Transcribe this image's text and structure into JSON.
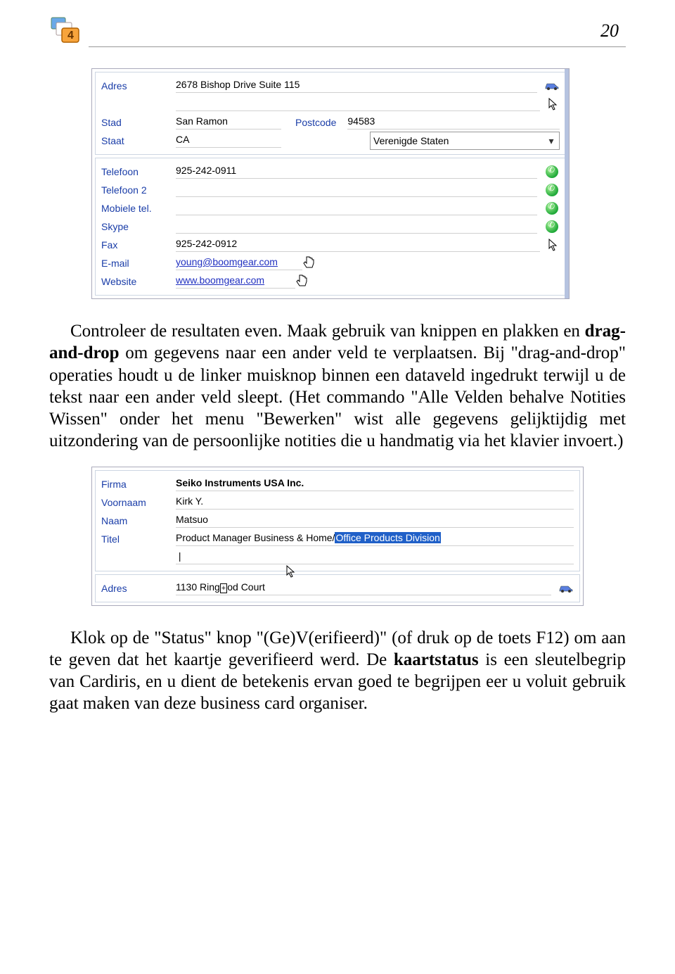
{
  "page_number": "20",
  "screenshot1": {
    "address": {
      "label": "Adres",
      "value": "2678 Bishop Drive Suite 115"
    },
    "city": {
      "label": "Stad",
      "value": "San Ramon"
    },
    "postcode": {
      "label": "Postcode",
      "value": "94583"
    },
    "state": {
      "label": "Staat",
      "value": "CA"
    },
    "country": {
      "value": "Verenigde Staten"
    },
    "phone": {
      "label": "Telefoon",
      "value": "925-242-0911"
    },
    "phone2": {
      "label": "Telefoon 2",
      "value": ""
    },
    "mobile": {
      "label": "Mobiele tel.",
      "value": ""
    },
    "skype": {
      "label": "Skype",
      "value": ""
    },
    "fax": {
      "label": "Fax",
      "value": "925-242-0912"
    },
    "email": {
      "label": "E-mail",
      "value": "young@boomgear.com"
    },
    "website": {
      "label": "Website",
      "value": "www.boomgear.com"
    }
  },
  "para1": {
    "pre": "Controleer de resultaten even. Maak gebruik van knippen en plakken en ",
    "bold": "drag-and-drop",
    "post": " om gegevens naar een ander veld te verplaatsen. Bij \"drag-and-drop\" operaties houdt u de linker muisknop binnen een dataveld ingedrukt terwijl u de tekst naar een ander veld sleept. (Het commando \"Alle Velden behalve Notities Wissen\" onder het menu \"Bewerken\" wist alle gegevens gelijktijdig met uitzondering van de persoonlijke notities die u handmatig via het klavier invoert.)"
  },
  "screenshot2": {
    "firm": {
      "label": "Firma",
      "value": "Seiko Instruments USA Inc."
    },
    "firstname": {
      "label": "Voornaam",
      "value": "Kirk Y."
    },
    "lastname": {
      "label": "Naam",
      "value": "Matsuo"
    },
    "title": {
      "label": "Titel",
      "value_pre": "Product Manager Business & Home/",
      "value_sel": "Office Products Division"
    },
    "address": {
      "label": "Adres",
      "value_pre": "1130 Ring",
      "value_post": "od Court"
    }
  },
  "para2": {
    "pre": "Klok op de \"Status\" knop \"(Ge)V(erifieerd)\" (of druk op de toets F12) om aan te geven dat het kaartje geverifieerd werd. De ",
    "bold": "kaartstatus",
    "post": " is een sleutelbegrip van Cardiris, en u dient de betekenis ervan goed te begrijpen eer u voluit gebruik gaat maken van deze business card organiser."
  }
}
